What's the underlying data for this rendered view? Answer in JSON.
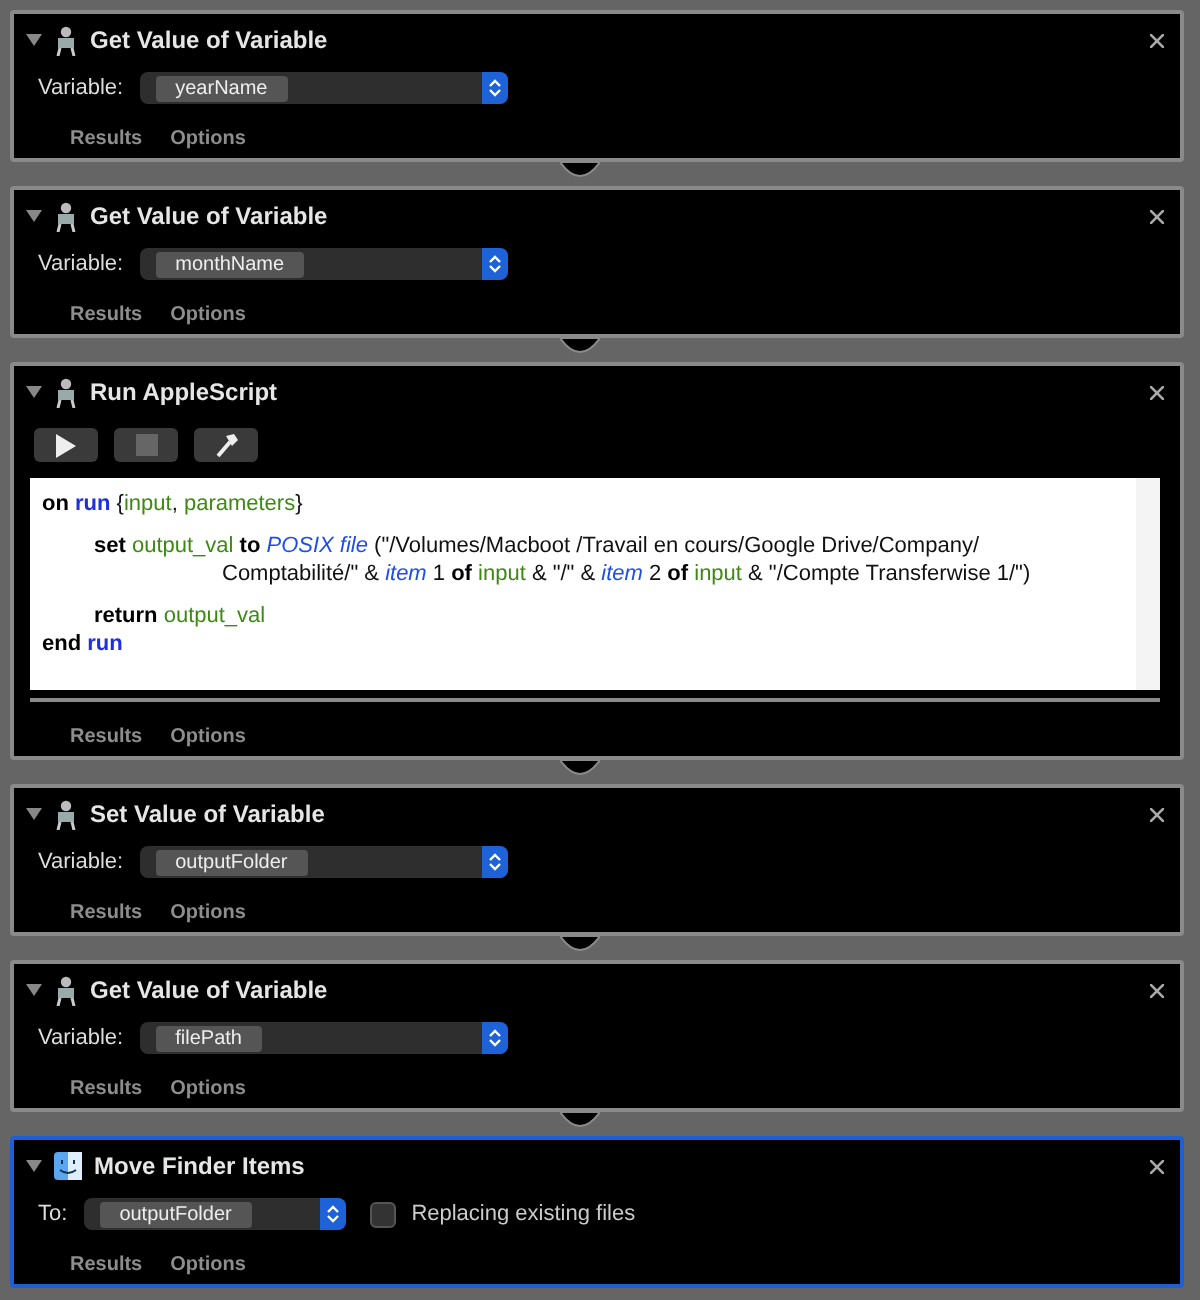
{
  "actions": [
    {
      "title": "Get Value of Variable",
      "expanded": true,
      "selected": false,
      "kind": "variable",
      "label": "Variable:",
      "value": "yearName",
      "tabs": [
        "Results",
        "Options"
      ]
    },
    {
      "title": "Get Value of Variable",
      "expanded": true,
      "selected": false,
      "kind": "variable",
      "label": "Variable:",
      "value": "monthName",
      "tabs": [
        "Results",
        "Options"
      ]
    },
    {
      "title": "Run AppleScript",
      "expanded": true,
      "selected": false,
      "kind": "script",
      "tabs": [
        "Results",
        "Options"
      ],
      "code": [
        {
          "kind": "plain",
          "tokens": [
            {
              "t": "on ",
              "kind": "keyword"
            },
            {
              "t": "run",
              "kind": "command"
            },
            {
              "t": " {",
              "kind": "plain"
            },
            {
              "t": "input",
              "kind": "variable"
            },
            {
              "t": ", ",
              "kind": "plain"
            },
            {
              "t": "parameters",
              "kind": "variable"
            },
            {
              "t": "}",
              "kind": "plain"
            }
          ]
        },
        {
          "kind": "blank"
        },
        {
          "kind": "nested",
          "tokens": [
            {
              "t": "set ",
              "kind": "keyword"
            },
            {
              "t": "output_val",
              "kind": "variable"
            },
            {
              "t": " to ",
              "kind": "keyword"
            },
            {
              "t": "POSIX file",
              "kind": "class"
            },
            {
              "t": " (\"/Volumes/Macboot /Travail en cours/Google Drive/Company/",
              "kind": "plain"
            }
          ]
        },
        {
          "kind": "continued",
          "tokens": [
            {
              "t": "Comptabilité/\" & ",
              "kind": "plain"
            },
            {
              "t": "item",
              "kind": "class"
            },
            {
              "t": " 1 ",
              "kind": "plain"
            },
            {
              "t": "of ",
              "kind": "keyword"
            },
            {
              "t": "input",
              "kind": "variable"
            },
            {
              "t": " & \"/\" & ",
              "kind": "plain"
            },
            {
              "t": "item",
              "kind": "class"
            },
            {
              "t": " 2 ",
              "kind": "plain"
            },
            {
              "t": "of ",
              "kind": "keyword"
            },
            {
              "t": "input",
              "kind": "variable"
            },
            {
              "t": " & \"/Compte Transferwise 1/\")",
              "kind": "plain"
            }
          ]
        },
        {
          "kind": "blank"
        },
        {
          "kind": "nested",
          "tokens": [
            {
              "t": "return ",
              "kind": "keyword"
            },
            {
              "t": "output_val",
              "kind": "variable"
            }
          ]
        },
        {
          "kind": "plain",
          "tokens": [
            {
              "t": "end ",
              "kind": "keyword"
            },
            {
              "t": "run",
              "kind": "command"
            }
          ]
        }
      ]
    },
    {
      "title": "Set Value of Variable",
      "expanded": true,
      "selected": false,
      "kind": "variable",
      "label": "Variable:",
      "value": "outputFolder",
      "tabs": [
        "Results",
        "Options"
      ]
    },
    {
      "title": "Get Value of Variable",
      "expanded": true,
      "selected": false,
      "kind": "variable",
      "label": "Variable:",
      "value": "filePath",
      "tabs": [
        "Results",
        "Options"
      ]
    },
    {
      "title": "Move Finder Items",
      "expanded": true,
      "selected": true,
      "kind": "move",
      "label": "To:",
      "value": "outputFolder",
      "option": {
        "label": "Replacing existing files",
        "checked": false
      },
      "tabs": [
        "Results",
        "Options"
      ]
    }
  ]
}
